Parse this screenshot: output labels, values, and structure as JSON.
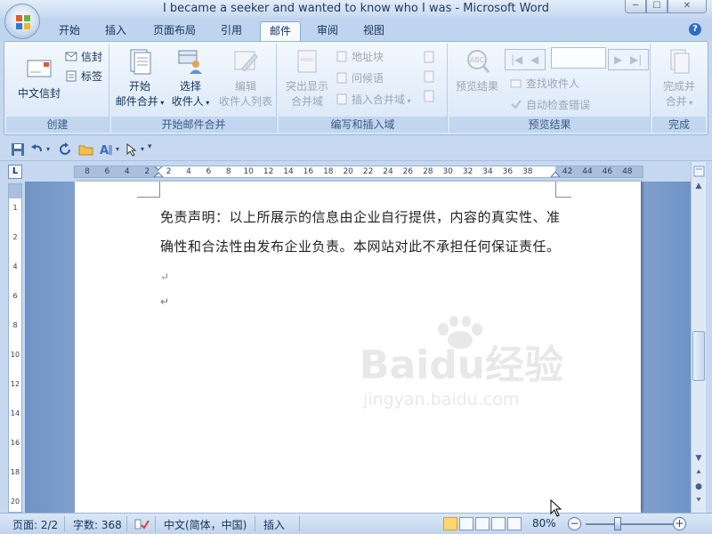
{
  "window": {
    "title": "I became a seeker and wanted to know who I was - Microsoft Word",
    "minimize_glyph": "─",
    "maximize_glyph": "☐",
    "close_glyph": "✕"
  },
  "tabs": [
    {
      "label": "开始",
      "active": false
    },
    {
      "label": "插入",
      "active": false
    },
    {
      "label": "页面布局",
      "active": false
    },
    {
      "label": "引用",
      "active": false
    },
    {
      "label": "邮件",
      "active": true
    },
    {
      "label": "审阅",
      "active": false
    },
    {
      "label": "视图",
      "active": false
    }
  ],
  "help_glyph": "?",
  "ribbon": {
    "create": {
      "label": "创建",
      "chinese_envelope": "中文信封",
      "envelope": "信封",
      "labels": "标签"
    },
    "start_merge": {
      "label": "开始邮件合并",
      "start_line1": "开始",
      "start_line2": "邮件合并",
      "select_line1": "选择",
      "select_line2": "收件人",
      "edit_line1": "编辑",
      "edit_line2": "收件人列表"
    },
    "write_insert": {
      "label": "编写和插入域",
      "highlight_line1": "突出显示",
      "highlight_line2": "合并域",
      "address_block": "地址块",
      "greeting_line": "问候语",
      "insert_merge_field": "插入合并域"
    },
    "preview": {
      "label": "预览结果",
      "preview_results": "预览结果",
      "find_recipient": "查找收件人",
      "auto_check": "自动检查错误",
      "preview_abc": "ABC"
    },
    "finish": {
      "label": "完成",
      "finish_line1": "完成并",
      "finish_line2": "合并"
    }
  },
  "ruler": {
    "toggle_glyph": "L",
    "h_numbers": [
      "8",
      "6",
      "4",
      "2",
      "2",
      "4",
      "6",
      "8",
      "10",
      "12",
      "14",
      "16",
      "18",
      "20",
      "22",
      "24",
      "26",
      "28",
      "30",
      "32",
      "34",
      "36",
      "38",
      "42",
      "44",
      "46",
      "48"
    ],
    "v_numbers": [
      "1",
      "2",
      "4",
      "6",
      "8",
      "10",
      "12",
      "14",
      "16",
      "18",
      "20"
    ]
  },
  "document": {
    "paragraph": "免责声明：以上所展示的信息由企业自行提供，内容的真实性、准确性和合法性由发布企业负责。本网站对此不承担任何保证责任。",
    "paragraph_mark": "↵",
    "watermark_brand": "Baidu经验",
    "watermark_url": "jingyan.baidu.com"
  },
  "status": {
    "page": "页面: 2/2",
    "words": "字数: 368",
    "language": "中文(简体，中国)",
    "mode": "插入",
    "zoom": "80%",
    "zoom_level_percent": 80,
    "zoom_minus": "−",
    "zoom_plus": "+"
  },
  "colors": {
    "accent": "#2f6cc2",
    "ribbon_bg": "#dbe7f6",
    "doc_bg": "#9cb7dd"
  }
}
